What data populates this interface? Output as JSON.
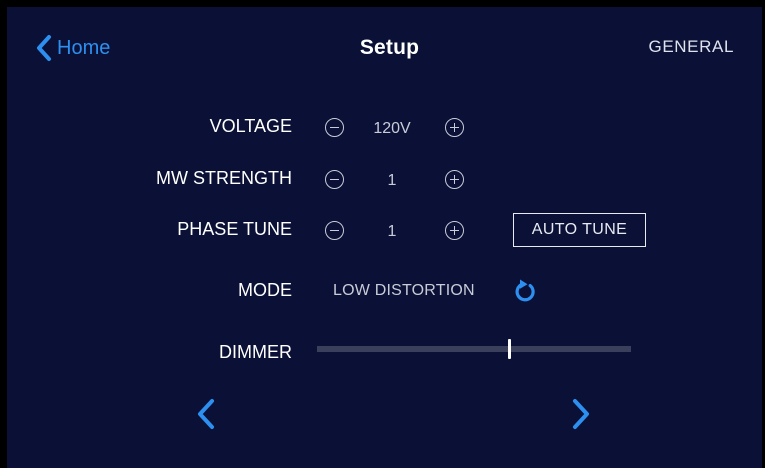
{
  "header": {
    "back_label": "Home",
    "title": "Setup",
    "section": "GENERAL"
  },
  "rows": {
    "voltage": {
      "label": "VOLTAGE",
      "value": "120V"
    },
    "mw_strength": {
      "label": "MW STRENGTH",
      "value": "1"
    },
    "phase_tune": {
      "label": "PHASE TUNE",
      "value": "1",
      "auto_tune_label": "AUTO TUNE"
    },
    "mode": {
      "label": "MODE",
      "value": "LOW DISTORTION"
    },
    "dimmer": {
      "label": "DIMMER",
      "level": 0.61
    }
  },
  "icons": {
    "back": "chevron-left-icon",
    "decrement": "minus-circle-icon",
    "increment": "plus-circle-icon",
    "mode_cycle": "refresh-icon",
    "prev_page": "chevron-left-icon",
    "next_page": "chevron-right-icon"
  },
  "colors": {
    "background": "#0b1136",
    "accent": "#2d8ff0",
    "text": "#ffffff",
    "muted": "#c9ccd8",
    "track": "#3a3f5c"
  }
}
